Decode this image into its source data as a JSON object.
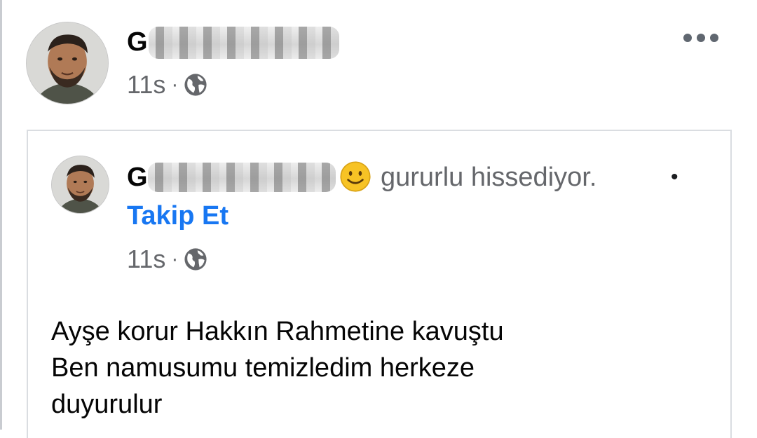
{
  "post": {
    "author_name_initial": "G",
    "time": "11s",
    "separator": "·",
    "privacy_icon": "globe-icon",
    "more_icon": "more-horizontal-icon"
  },
  "shared_post": {
    "author_name_initial": "G",
    "feeling_emoji": "smiling-face-icon",
    "feeling_text": "gururlu hissediyor.",
    "bullet": "•",
    "follow_label": "Takip Et",
    "time": "11s",
    "separator": "·",
    "privacy_icon": "globe-icon",
    "text_lines": [
      "Ayşe korur Hakkın Rahmetine kavuştu",
      "Ben namusumu temizledim herkeze",
      "duyurulur"
    ]
  },
  "colors": {
    "link": "#1877f2",
    "meta": "#65676b",
    "text": "#050505",
    "emoji": "#f7c325"
  }
}
